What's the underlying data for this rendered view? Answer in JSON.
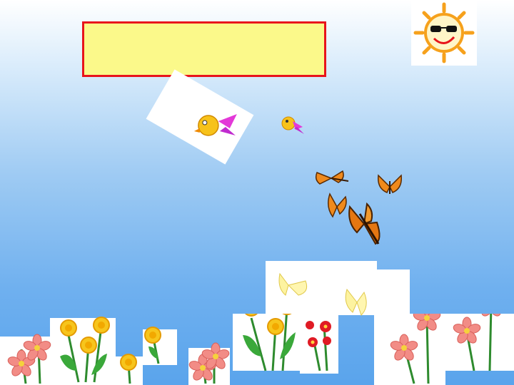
{
  "slide": {
    "title_box_text": "",
    "colors": {
      "sky_top": "#ffffff",
      "sky_bottom": "#5aa4ec",
      "title_fill": "#fbf98a",
      "title_border": "#e8141b"
    }
  },
  "decorations": {
    "sun": "sun-with-sunglasses-icon",
    "birds": [
      "yellow-bird-icon",
      "yellow-bird-icon"
    ],
    "butterflies": [
      "orange-butterfly-icon",
      "orange-butterfly-icon",
      "orange-butterfly-icon",
      "orange-butterfly-icon",
      "yellow-butterfly-icon",
      "yellow-butterfly-icon"
    ],
    "flowers": [
      "dandelion-icon",
      "cosmos-flower-icon",
      "red-flower-icon"
    ]
  }
}
